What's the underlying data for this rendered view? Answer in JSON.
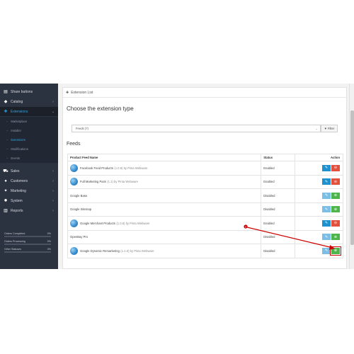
{
  "sidebar": {
    "items": [
      {
        "icon": "share-icon",
        "glyph": "▤",
        "label": "Share buttons",
        "chev": ""
      },
      {
        "icon": "tag-icon",
        "glyph": "◆",
        "label": "Catalog",
        "chev": "›"
      },
      {
        "icon": "puzzle-icon",
        "glyph": "✚",
        "label": "Extensions",
        "chev": "⌄"
      },
      {
        "icon": "desktop-icon",
        "glyph": "▭",
        "label": "Design",
        "chev": "›"
      },
      {
        "icon": "cart-icon",
        "glyph": "⛟",
        "label": "Sales",
        "chev": "›"
      },
      {
        "icon": "user-icon",
        "glyph": "●",
        "label": "Customers",
        "chev": "›"
      },
      {
        "icon": "share-alt-icon",
        "glyph": "✦",
        "label": "Marketing",
        "chev": "›"
      },
      {
        "icon": "cog-icon",
        "glyph": "✹",
        "label": "System",
        "chev": "›"
      },
      {
        "icon": "bar-chart-icon",
        "glyph": "▥",
        "label": "Reports",
        "chev": "›"
      }
    ],
    "sub_items": [
      "Marketplace",
      "Installer",
      "Extensions",
      "Modifications",
      "Events"
    ],
    "stats": [
      {
        "label": "Orders Completed",
        "value": "0%",
        "fill": 0
      },
      {
        "label": "Orders Processing",
        "value": "0%",
        "fill": 0
      },
      {
        "label": "Other Statuses",
        "value": "0%",
        "fill": 0
      }
    ]
  },
  "panel": {
    "heading": "Extension List",
    "choose_title": "Choose the extension type",
    "select_value": "Feeds (7)",
    "filter_label": "Filter",
    "feeds_title": "Feeds"
  },
  "table": {
    "headers": {
      "name": "Product Feed Name",
      "status": "Status",
      "action": "Action"
    },
    "rows": [
      {
        "name": "Facebook Feed Products",
        "version": "(1.0.9) by Pinta Webware",
        "logo": true,
        "status": "Enabled",
        "installed": true
      },
      {
        "name": "Full Marketing Pack",
        "version": "(1.1) by Pinta Webware",
        "logo": true,
        "status": "Enabled",
        "installed": true
      },
      {
        "name": "Google Base",
        "version": "",
        "logo": false,
        "status": "Disabled",
        "installed": false
      },
      {
        "name": "Google Sitemap",
        "version": "",
        "logo": false,
        "status": "Disabled",
        "installed": false
      },
      {
        "name": "Google Merchant Products",
        "version": "(1.0.6) by Pinta Webware",
        "logo": true,
        "status": "Enabled",
        "installed": true
      },
      {
        "name": "OpenBay Pro",
        "version": "",
        "logo": false,
        "status": "Disabled",
        "installed": false
      },
      {
        "name": "Google Dynamic Remarketing",
        "version": "(1.1.0) by Pinta Webware",
        "logo": true,
        "status": "Disabled",
        "installed": false
      }
    ]
  },
  "annotation": {
    "color": "#cc0000"
  },
  "colors": {
    "sidebar_bg": "#2c3340",
    "accent": "#2fa4e7",
    "edit_btn": "#1e91cf",
    "delete_btn": "#e3503e",
    "install_btn": "#4cb64c"
  }
}
